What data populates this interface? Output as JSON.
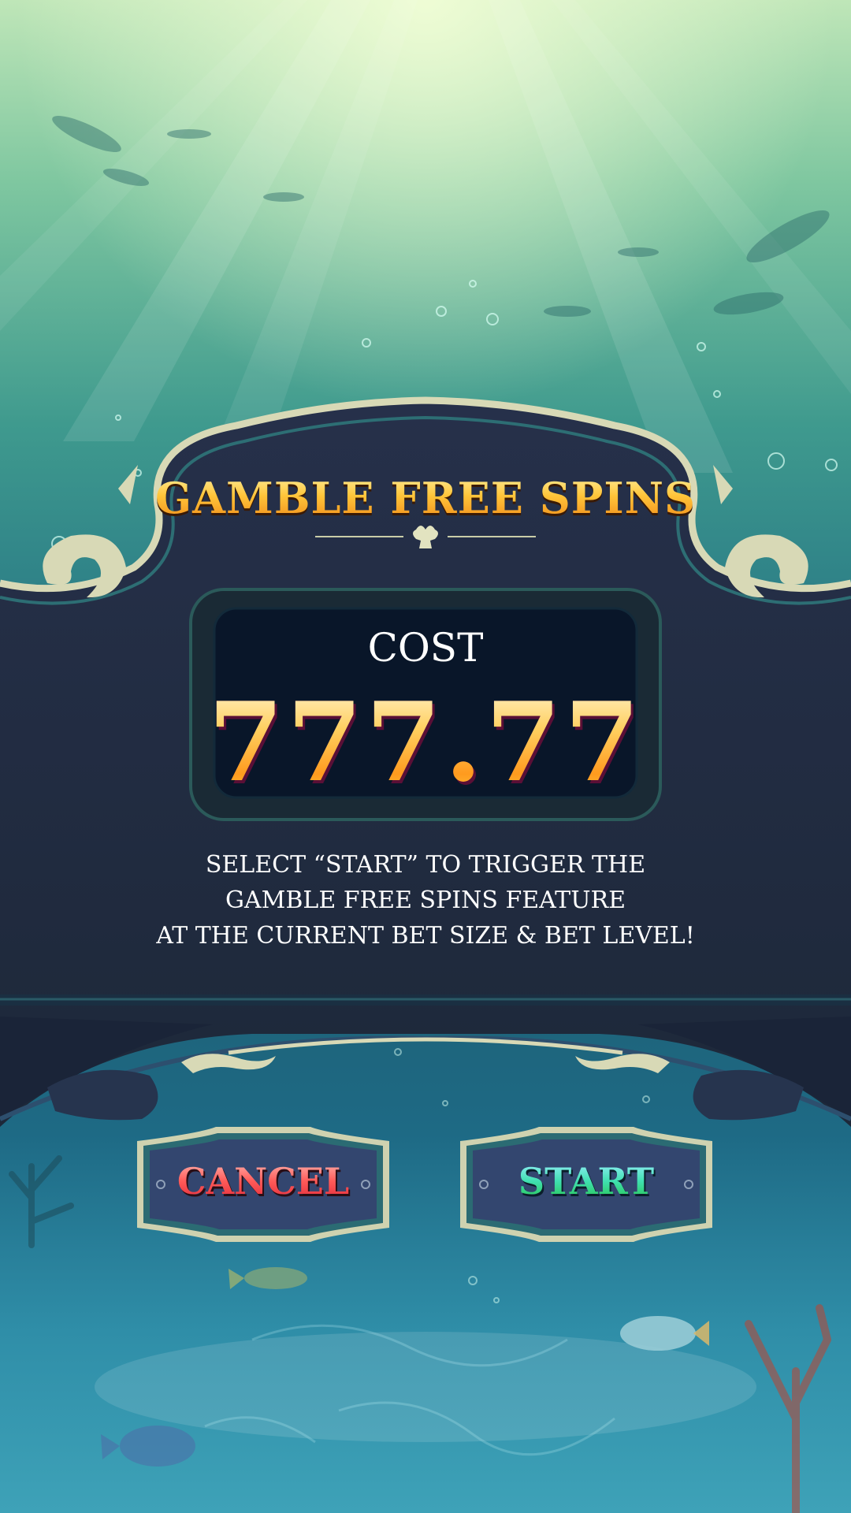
{
  "dialog": {
    "title": "GAMBLE FREE SPINS",
    "cost_label": "COST",
    "cost_value": "777.77",
    "description_lines": [
      "SELECT “START” TO TRIGGER THE",
      "GAMBLE FREE SPINS FEATURE",
      "AT THE CURRENT BET SIZE & BET LEVEL!"
    ]
  },
  "buttons": {
    "cancel_label": "CANCEL",
    "start_label": "START"
  },
  "colors": {
    "panel": "#202b3d",
    "cost_box": "#091629",
    "trim": "#d8d9b6",
    "title_gold": "#ffb02e"
  }
}
